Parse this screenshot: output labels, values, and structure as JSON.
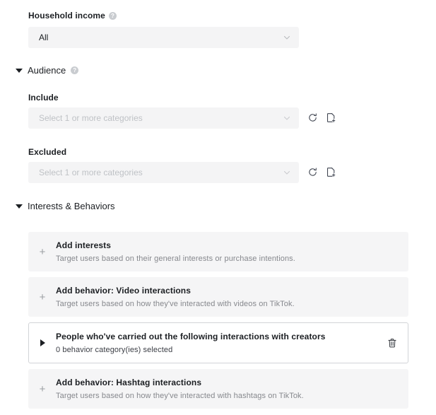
{
  "household_income": {
    "label": "Household income",
    "help_icon": "help-circle-icon",
    "selected_value": "All",
    "chevron_icon": "chevron-down-icon"
  },
  "audience": {
    "caret_icon": "caret-down-icon",
    "title": "Audience",
    "help_icon": "help-circle-icon",
    "include": {
      "label": "Include",
      "placeholder": "Select 1 or more categories",
      "value": "",
      "chevron_icon": "chevron-down-icon",
      "refresh_icon": "refresh-icon",
      "create_icon": "file-plus-icon"
    },
    "excluded": {
      "label": "Excluded",
      "placeholder": "Select 1 or more categories",
      "value": "",
      "chevron_icon": "chevron-down-icon",
      "refresh_icon": "refresh-icon",
      "create_icon": "file-plus-icon"
    }
  },
  "interests_behaviors": {
    "caret_icon": "caret-down-icon",
    "title": "Interests & Behaviors",
    "cards": [
      {
        "handle_icon": "plus-icon",
        "title": "Add interests",
        "description": "Target users based on their general interests or purchase intentions.",
        "selected": false
      },
      {
        "handle_icon": "plus-icon",
        "title": "Add behavior: Video interactions",
        "description": "Target users based on how they've interacted with videos on TikTok.",
        "selected": false
      },
      {
        "handle_icon": "caret-right-icon",
        "title": "People who've carried out the following interactions with creators",
        "description": "0 behavior category(ies) selected",
        "selected": true,
        "delete_icon": "trash-icon"
      },
      {
        "handle_icon": "plus-icon",
        "title": "Add behavior: Hashtag interactions",
        "description": "Target users based on how they've interacted with hashtags on TikTok.",
        "selected": false
      }
    ]
  }
}
